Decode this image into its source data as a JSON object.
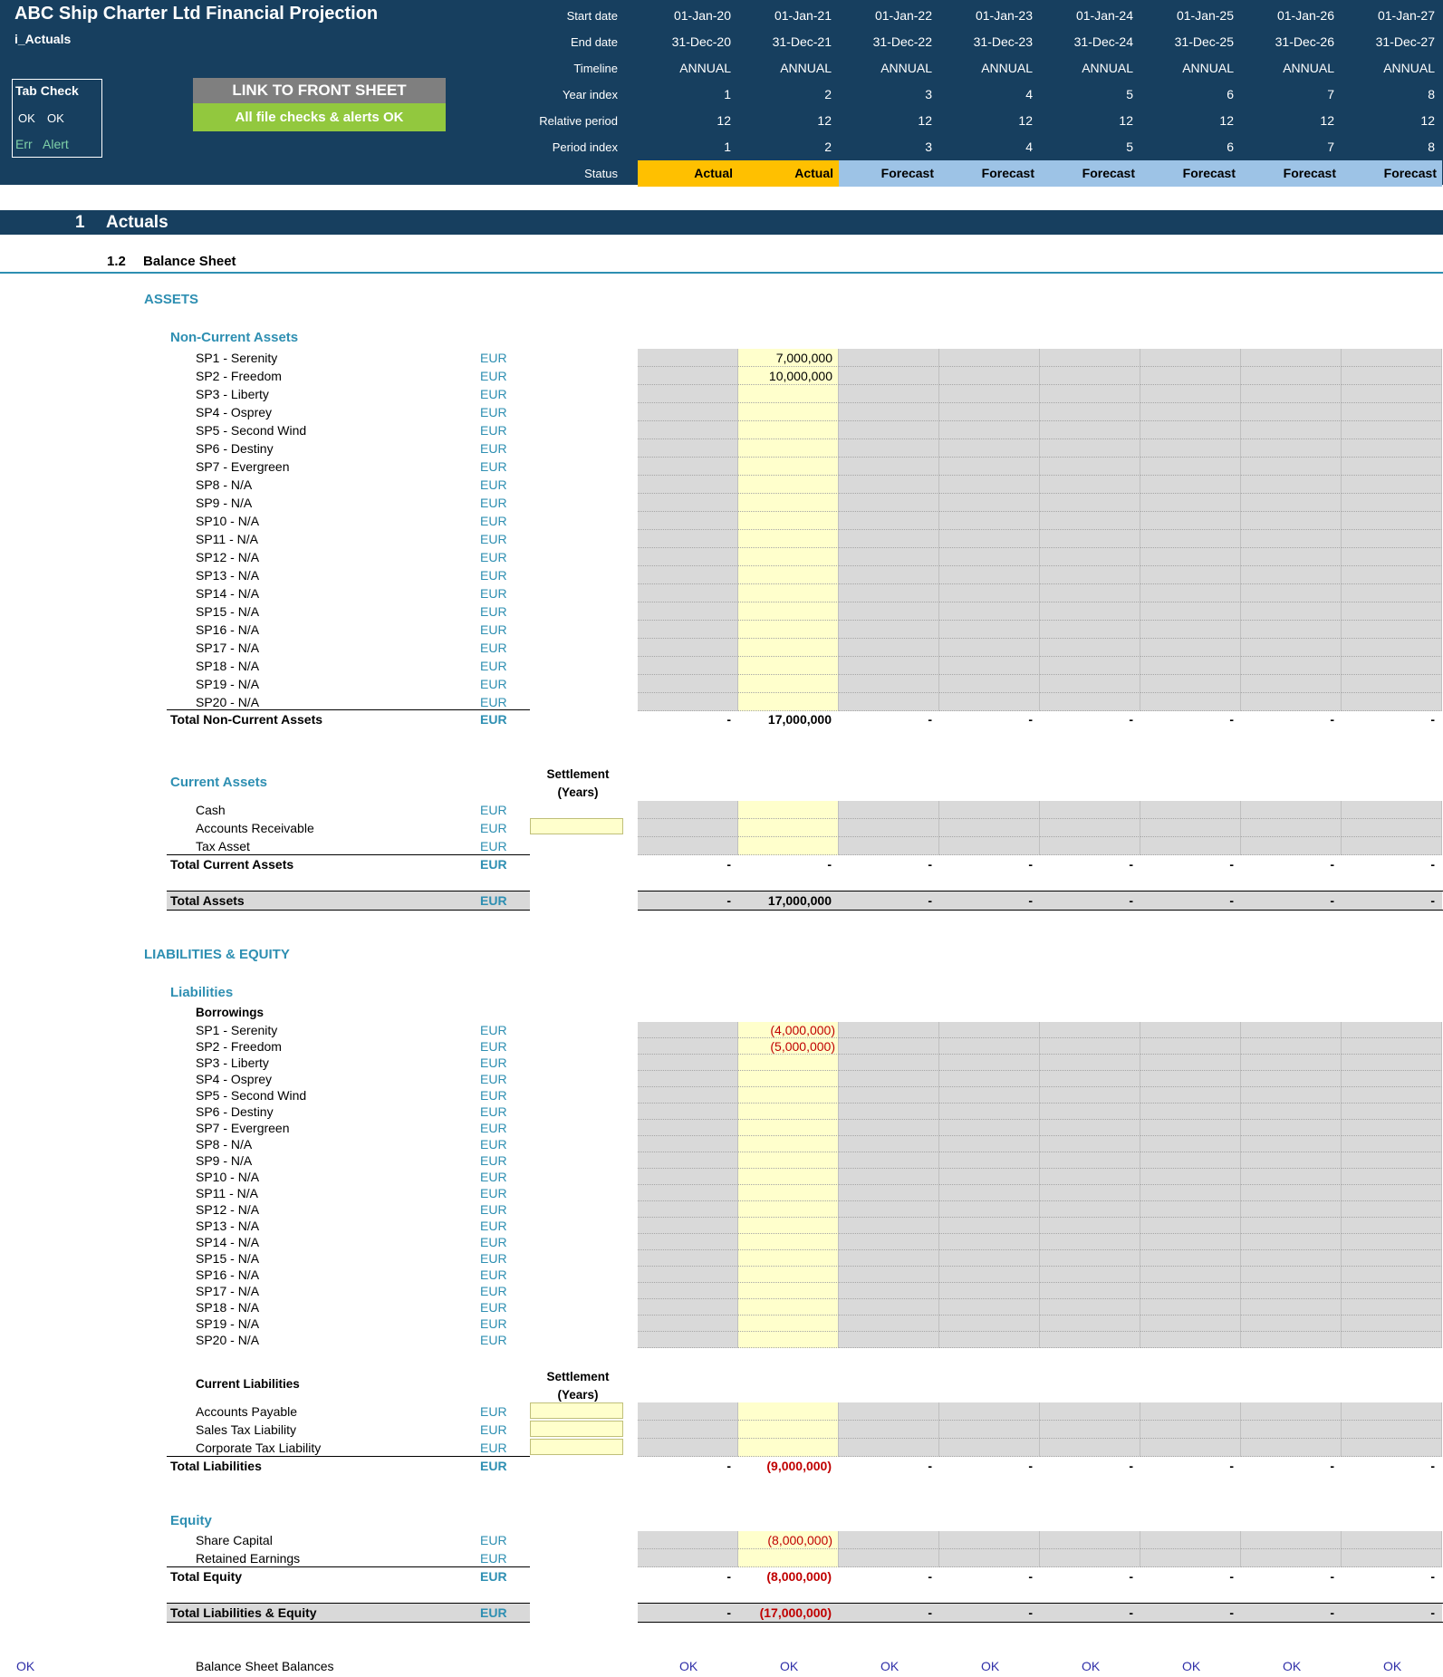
{
  "header": {
    "title": "ABC Ship Charter Ltd Financial Projection",
    "sheet": "i_Actuals",
    "tab_check": {
      "title": "Tab Check",
      "ok1": "OK",
      "ok2": "OK",
      "err": "Err",
      "alert": "Alert"
    },
    "link_button": "LINK TO FRONT SHEET",
    "checks_button": "All file checks & alerts OK",
    "row_labels": [
      "Start date",
      "End date",
      "Timeline",
      "Year index",
      "Relative period",
      "Period index",
      "Status"
    ],
    "columns": [
      {
        "start": "01-Jan-20",
        "end": "31-Dec-20",
        "timeline": "ANNUAL",
        "year": "1",
        "rel": "12",
        "period": "1",
        "status": "Actual"
      },
      {
        "start": "01-Jan-21",
        "end": "31-Dec-21",
        "timeline": "ANNUAL",
        "year": "2",
        "rel": "12",
        "period": "2",
        "status": "Actual"
      },
      {
        "start": "01-Jan-22",
        "end": "31-Dec-22",
        "timeline": "ANNUAL",
        "year": "3",
        "rel": "12",
        "period": "3",
        "status": "Forecast"
      },
      {
        "start": "01-Jan-23",
        "end": "31-Dec-23",
        "timeline": "ANNUAL",
        "year": "4",
        "rel": "12",
        "period": "4",
        "status": "Forecast"
      },
      {
        "start": "01-Jan-24",
        "end": "31-Dec-24",
        "timeline": "ANNUAL",
        "year": "5",
        "rel": "12",
        "period": "5",
        "status": "Forecast"
      },
      {
        "start": "01-Jan-25",
        "end": "31-Dec-25",
        "timeline": "ANNUAL",
        "year": "6",
        "rel": "12",
        "period": "6",
        "status": "Forecast"
      },
      {
        "start": "01-Jan-26",
        "end": "31-Dec-26",
        "timeline": "ANNUAL",
        "year": "7",
        "rel": "12",
        "period": "7",
        "status": "Forecast"
      },
      {
        "start": "01-Jan-27",
        "end": "31-Dec-27",
        "timeline": "ANNUAL",
        "year": "8",
        "rel": "12",
        "period": "8",
        "status": "Forecast"
      }
    ]
  },
  "section": {
    "number": "1",
    "title": "Actuals",
    "sub_number": "1.2",
    "sub_title": "Balance Sheet"
  },
  "assets": {
    "heading": "ASSETS",
    "nca_heading": "Non-Current Assets",
    "nca_items": [
      "SP1 - Serenity",
      "SP2 - Freedom",
      "SP3 - Liberty",
      "SP4 - Osprey",
      "SP5 - Second Wind",
      "SP6 - Destiny",
      "SP7 - Evergreen",
      "SP8 - N/A",
      "SP9 - N/A",
      "SP10 - N/A",
      "SP11 - N/A",
      "SP12 - N/A",
      "SP13 - N/A",
      "SP14 - N/A",
      "SP15 - N/A",
      "SP16 - N/A",
      "SP17 - N/A",
      "SP18 - N/A",
      "SP19 - N/A",
      "SP20 - N/A"
    ],
    "nca_values": [
      "7,000,000",
      "10,000,000"
    ],
    "total_nca_label": "Total Non-Current Assets",
    "total_nca_values": [
      "-",
      "17,000,000",
      "-",
      "-",
      "-",
      "-",
      "-",
      "-"
    ],
    "ca_heading": "Current Assets",
    "settlement": [
      "Settlement",
      "(Years)"
    ],
    "ca_items": [
      "Cash",
      "Accounts Receivable",
      "Tax Asset"
    ],
    "total_ca_label": "Total Current Assets",
    "total_ca_values": [
      "-",
      "-",
      "-",
      "-",
      "-",
      "-",
      "-",
      "-"
    ],
    "total_assets_label": "Total Assets",
    "total_assets_values": [
      "-",
      "17,000,000",
      "-",
      "-",
      "-",
      "-",
      "-",
      "-"
    ]
  },
  "liabilities": {
    "heading": "LIABILITIES & EQUITY",
    "liab_heading": "Liabilities",
    "borrowings_heading": "Borrowings",
    "borrow_values": [
      "(4,000,000)",
      "(5,000,000)"
    ],
    "cl_heading": "Current Liabilities",
    "cl_items": [
      "Accounts Payable",
      "Sales Tax Liability",
      "Corporate Tax Liability"
    ],
    "total_liab_label": "Total Liabilities",
    "total_liab_values": [
      "-",
      "(9,000,000)",
      "-",
      "-",
      "-",
      "-",
      "-",
      "-"
    ],
    "equity_heading": "Equity",
    "equity_items": [
      "Share Capital",
      "Retained Earnings"
    ],
    "share_capital_value": "(8,000,000)",
    "total_equity_label": "Total Equity",
    "total_equity_values": [
      "-",
      "(8,000,000)",
      "-",
      "-",
      "-",
      "-",
      "-",
      "-"
    ],
    "total_le_label": "Total Liabilities & Equity",
    "total_le_values": [
      "-",
      "(17,000,000)",
      "-",
      "-",
      "-",
      "-",
      "-",
      "-"
    ]
  },
  "unit": "EUR",
  "check": {
    "left": "OK",
    "label": "Balance Sheet Balances",
    "values": [
      "OK",
      "OK",
      "OK",
      "OK",
      "OK",
      "OK",
      "OK",
      "OK"
    ]
  },
  "colors": {
    "header_bg": "#173f5f",
    "actual": "#ffc000",
    "forecast": "#9dc3e6",
    "input_cell": "#ffffcc",
    "calc_cell": "#d9d9d9",
    "teal": "#2e8fb2",
    "ok_green": "#92c83e"
  }
}
